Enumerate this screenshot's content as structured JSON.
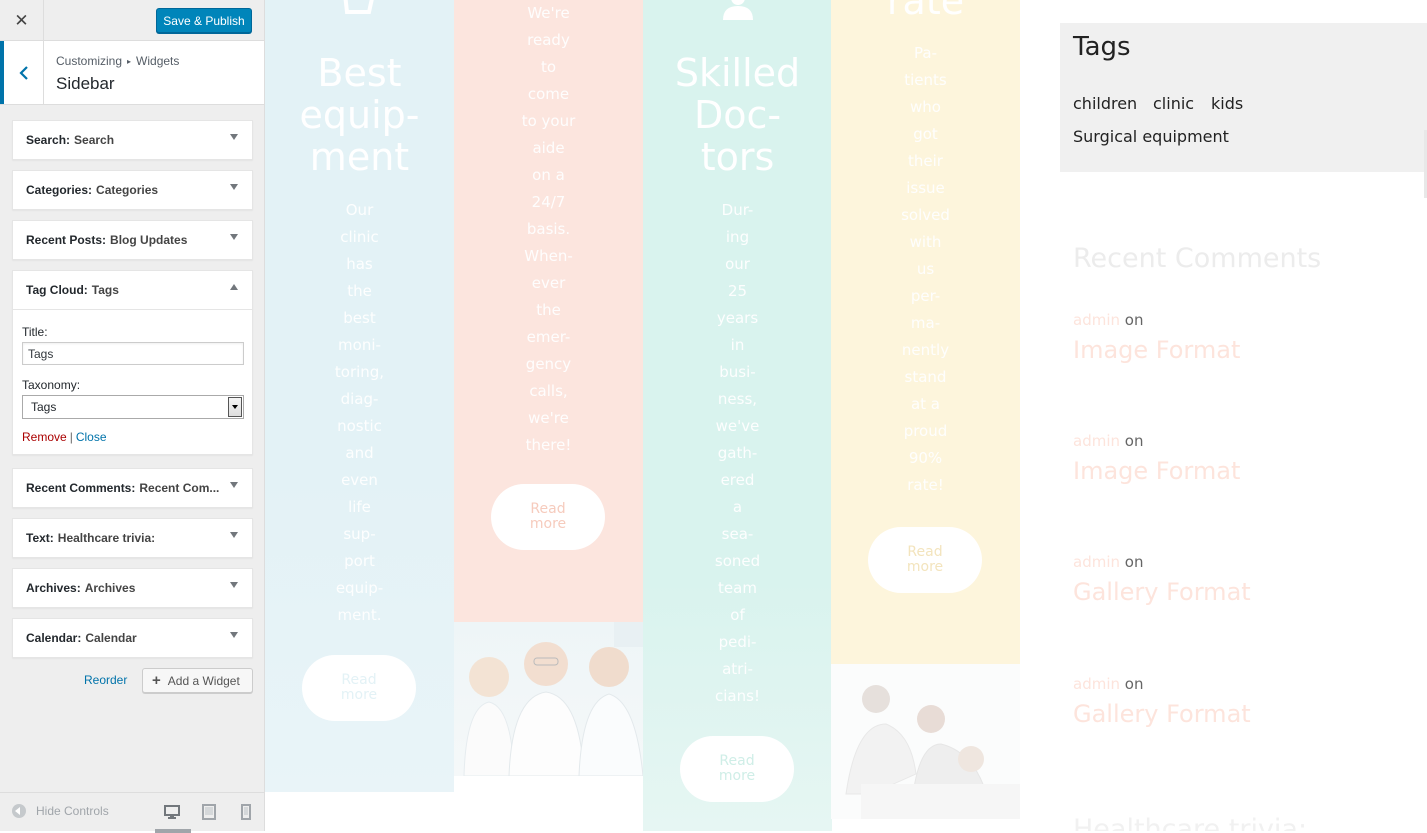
{
  "topbar": {
    "close_label": "✕",
    "publish_label": "Save & Publish"
  },
  "section": {
    "crumb_1": "Customizing",
    "crumb_sep": "▸",
    "crumb_2": "Widgets",
    "title": "Sidebar"
  },
  "widgets": [
    {
      "type": "Search:",
      "title": "Search"
    },
    {
      "type": "Categories:",
      "title": "Categories"
    },
    {
      "type": "Recent Posts:",
      "title": "Blog Updates"
    },
    {
      "type": "Tag Cloud:",
      "title": "Tags"
    },
    {
      "type": "Recent Comments:",
      "title": "Recent Com..."
    },
    {
      "type": "Text:",
      "title": "Healthcare trivia:"
    },
    {
      "type": "Archives:",
      "title": "Archives"
    },
    {
      "type": "Calendar:",
      "title": "Calendar"
    }
  ],
  "tag_cloud_form": {
    "title_label": "Title:",
    "title_value": "Tags",
    "taxonomy_label": "Taxonomy:",
    "taxonomy_value": "Tags",
    "remove_label": "Remove",
    "separator": "|",
    "close_label": "Close"
  },
  "panel_actions": {
    "reorder_label": "Reorder",
    "add_widget_label": "Add a Widget"
  },
  "footer": {
    "hide_controls_label": "Hide Controls",
    "devices": [
      "desktop-icon",
      "tablet-icon",
      "mobile-icon"
    ]
  },
  "preview": {
    "columns": [
      {
        "heading": [
          "Best",
          "equip-",
          "ment"
        ],
        "text": [
          "Our",
          "clinic",
          "has",
          "the",
          "best",
          "moni-",
          "toring,",
          "diag-",
          "nostic",
          "and",
          "even",
          "life",
          "sup-",
          "port",
          "equip-",
          "ment."
        ],
        "button": [
          "Read",
          "more"
        ],
        "bg": "#e3f2f6",
        "accent": "#cfe9f1"
      },
      {
        "heading": [],
        "text": [
          "We're",
          "ready",
          "to",
          "come",
          "to your",
          "aide",
          "on a",
          "24/7",
          "basis.",
          "When-",
          "ever",
          "the",
          "emer-",
          "gency",
          "calls,",
          "we're",
          "there!"
        ],
        "button": [
          "Read",
          "more"
        ],
        "bg": "#fce5de",
        "accent": "#f8cdbf"
      },
      {
        "heading": [
          "Skilled",
          "Doc-",
          "tors"
        ],
        "text": [
          "Dur-",
          "ing",
          "our",
          "25",
          "years",
          "in",
          "busi-",
          "ness,",
          "we've",
          "gath-",
          "ered",
          "a",
          "sea-",
          "soned",
          "team",
          "of",
          "pedi-",
          "atri-",
          "cians!"
        ],
        "button": [
          "Read",
          "more"
        ],
        "bg": "#d9f3ee",
        "accent": "#bde9e0"
      },
      {
        "heading": [
          "rate"
        ],
        "text": [
          "Pa-",
          "tients",
          "who",
          "got",
          "their",
          "issue",
          "solved",
          "with",
          "us",
          "per-",
          "ma-",
          "nently",
          "stand",
          "at a",
          "proud",
          "90%",
          "rate!"
        ],
        "button": [
          "Read",
          "more"
        ],
        "bg": "#fdf5dc",
        "accent": "#f6e6b5"
      }
    ],
    "tags_title": "Tags",
    "tags": [
      "children",
      "clinic",
      "kids",
      "Surgical equipment"
    ],
    "recent_comments_title": "Recent Comments",
    "comments": [
      {
        "author": "admin",
        "on": "on",
        "post": "Image Format"
      },
      {
        "author": "admin",
        "on": "on",
        "post": "Image Format"
      },
      {
        "author": "admin",
        "on": "on",
        "post": "Gallery Format"
      },
      {
        "author": "admin",
        "on": "on",
        "post": "Gallery Format"
      }
    ],
    "next_widget_title": "Healthcare trivia:"
  },
  "colors": {
    "accent_blue": "#0085ba",
    "link_blue": "#0073aa",
    "remove_red": "#aa0000"
  }
}
